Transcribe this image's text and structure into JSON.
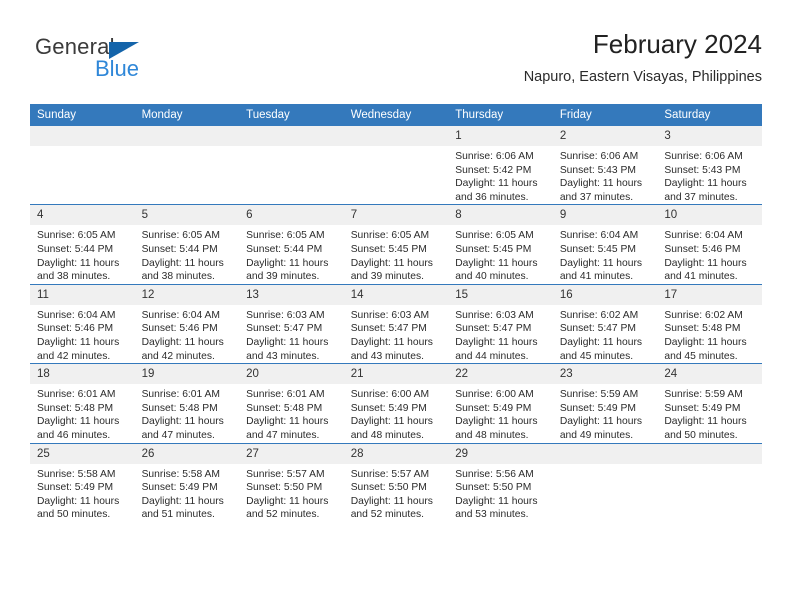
{
  "brand": {
    "name_part1": "General",
    "name_part2": "Blue",
    "triangle_icon": "blue-triangle-icon",
    "accent_blue": "#2f87d8",
    "dark_blue": "#1464aa"
  },
  "header": {
    "title": "February 2024",
    "subtitle": "Napuro, Eastern Visayas, Philippines"
  },
  "theme": {
    "header_row_bg": "#3479bc",
    "daynum_bg": "#f0f0f0",
    "grid_line": "#3479bc",
    "text": "#2b2b2b"
  },
  "weekdays": [
    "Sunday",
    "Monday",
    "Tuesday",
    "Wednesday",
    "Thursday",
    "Friday",
    "Saturday"
  ],
  "weeks": [
    [
      {
        "day": "",
        "sunrise": "",
        "sunset": "",
        "daylight_line1": "",
        "daylight_line2": ""
      },
      {
        "day": "",
        "sunrise": "",
        "sunset": "",
        "daylight_line1": "",
        "daylight_line2": ""
      },
      {
        "day": "",
        "sunrise": "",
        "sunset": "",
        "daylight_line1": "",
        "daylight_line2": ""
      },
      {
        "day": "",
        "sunrise": "",
        "sunset": "",
        "daylight_line1": "",
        "daylight_line2": ""
      },
      {
        "day": "1",
        "sunrise": "Sunrise: 6:06 AM",
        "sunset": "Sunset: 5:42 PM",
        "daylight_line1": "Daylight: 11 hours",
        "daylight_line2": "and 36 minutes."
      },
      {
        "day": "2",
        "sunrise": "Sunrise: 6:06 AM",
        "sunset": "Sunset: 5:43 PM",
        "daylight_line1": "Daylight: 11 hours",
        "daylight_line2": "and 37 minutes."
      },
      {
        "day": "3",
        "sunrise": "Sunrise: 6:06 AM",
        "sunset": "Sunset: 5:43 PM",
        "daylight_line1": "Daylight: 11 hours",
        "daylight_line2": "and 37 minutes."
      }
    ],
    [
      {
        "day": "4",
        "sunrise": "Sunrise: 6:05 AM",
        "sunset": "Sunset: 5:44 PM",
        "daylight_line1": "Daylight: 11 hours",
        "daylight_line2": "and 38 minutes."
      },
      {
        "day": "5",
        "sunrise": "Sunrise: 6:05 AM",
        "sunset": "Sunset: 5:44 PM",
        "daylight_line1": "Daylight: 11 hours",
        "daylight_line2": "and 38 minutes."
      },
      {
        "day": "6",
        "sunrise": "Sunrise: 6:05 AM",
        "sunset": "Sunset: 5:44 PM",
        "daylight_line1": "Daylight: 11 hours",
        "daylight_line2": "and 39 minutes."
      },
      {
        "day": "7",
        "sunrise": "Sunrise: 6:05 AM",
        "sunset": "Sunset: 5:45 PM",
        "daylight_line1": "Daylight: 11 hours",
        "daylight_line2": "and 39 minutes."
      },
      {
        "day": "8",
        "sunrise": "Sunrise: 6:05 AM",
        "sunset": "Sunset: 5:45 PM",
        "daylight_line1": "Daylight: 11 hours",
        "daylight_line2": "and 40 minutes."
      },
      {
        "day": "9",
        "sunrise": "Sunrise: 6:04 AM",
        "sunset": "Sunset: 5:45 PM",
        "daylight_line1": "Daylight: 11 hours",
        "daylight_line2": "and 41 minutes."
      },
      {
        "day": "10",
        "sunrise": "Sunrise: 6:04 AM",
        "sunset": "Sunset: 5:46 PM",
        "daylight_line1": "Daylight: 11 hours",
        "daylight_line2": "and 41 minutes."
      }
    ],
    [
      {
        "day": "11",
        "sunrise": "Sunrise: 6:04 AM",
        "sunset": "Sunset: 5:46 PM",
        "daylight_line1": "Daylight: 11 hours",
        "daylight_line2": "and 42 minutes."
      },
      {
        "day": "12",
        "sunrise": "Sunrise: 6:04 AM",
        "sunset": "Sunset: 5:46 PM",
        "daylight_line1": "Daylight: 11 hours",
        "daylight_line2": "and 42 minutes."
      },
      {
        "day": "13",
        "sunrise": "Sunrise: 6:03 AM",
        "sunset": "Sunset: 5:47 PM",
        "daylight_line1": "Daylight: 11 hours",
        "daylight_line2": "and 43 minutes."
      },
      {
        "day": "14",
        "sunrise": "Sunrise: 6:03 AM",
        "sunset": "Sunset: 5:47 PM",
        "daylight_line1": "Daylight: 11 hours",
        "daylight_line2": "and 43 minutes."
      },
      {
        "day": "15",
        "sunrise": "Sunrise: 6:03 AM",
        "sunset": "Sunset: 5:47 PM",
        "daylight_line1": "Daylight: 11 hours",
        "daylight_line2": "and 44 minutes."
      },
      {
        "day": "16",
        "sunrise": "Sunrise: 6:02 AM",
        "sunset": "Sunset: 5:47 PM",
        "daylight_line1": "Daylight: 11 hours",
        "daylight_line2": "and 45 minutes."
      },
      {
        "day": "17",
        "sunrise": "Sunrise: 6:02 AM",
        "sunset": "Sunset: 5:48 PM",
        "daylight_line1": "Daylight: 11 hours",
        "daylight_line2": "and 45 minutes."
      }
    ],
    [
      {
        "day": "18",
        "sunrise": "Sunrise: 6:01 AM",
        "sunset": "Sunset: 5:48 PM",
        "daylight_line1": "Daylight: 11 hours",
        "daylight_line2": "and 46 minutes."
      },
      {
        "day": "19",
        "sunrise": "Sunrise: 6:01 AM",
        "sunset": "Sunset: 5:48 PM",
        "daylight_line1": "Daylight: 11 hours",
        "daylight_line2": "and 47 minutes."
      },
      {
        "day": "20",
        "sunrise": "Sunrise: 6:01 AM",
        "sunset": "Sunset: 5:48 PM",
        "daylight_line1": "Daylight: 11 hours",
        "daylight_line2": "and 47 minutes."
      },
      {
        "day": "21",
        "sunrise": "Sunrise: 6:00 AM",
        "sunset": "Sunset: 5:49 PM",
        "daylight_line1": "Daylight: 11 hours",
        "daylight_line2": "and 48 minutes."
      },
      {
        "day": "22",
        "sunrise": "Sunrise: 6:00 AM",
        "sunset": "Sunset: 5:49 PM",
        "daylight_line1": "Daylight: 11 hours",
        "daylight_line2": "and 48 minutes."
      },
      {
        "day": "23",
        "sunrise": "Sunrise: 5:59 AM",
        "sunset": "Sunset: 5:49 PM",
        "daylight_line1": "Daylight: 11 hours",
        "daylight_line2": "and 49 minutes."
      },
      {
        "day": "24",
        "sunrise": "Sunrise: 5:59 AM",
        "sunset": "Sunset: 5:49 PM",
        "daylight_line1": "Daylight: 11 hours",
        "daylight_line2": "and 50 minutes."
      }
    ],
    [
      {
        "day": "25",
        "sunrise": "Sunrise: 5:58 AM",
        "sunset": "Sunset: 5:49 PM",
        "daylight_line1": "Daylight: 11 hours",
        "daylight_line2": "and 50 minutes."
      },
      {
        "day": "26",
        "sunrise": "Sunrise: 5:58 AM",
        "sunset": "Sunset: 5:49 PM",
        "daylight_line1": "Daylight: 11 hours",
        "daylight_line2": "and 51 minutes."
      },
      {
        "day": "27",
        "sunrise": "Sunrise: 5:57 AM",
        "sunset": "Sunset: 5:50 PM",
        "daylight_line1": "Daylight: 11 hours",
        "daylight_line2": "and 52 minutes."
      },
      {
        "day": "28",
        "sunrise": "Sunrise: 5:57 AM",
        "sunset": "Sunset: 5:50 PM",
        "daylight_line1": "Daylight: 11 hours",
        "daylight_line2": "and 52 minutes."
      },
      {
        "day": "29",
        "sunrise": "Sunrise: 5:56 AM",
        "sunset": "Sunset: 5:50 PM",
        "daylight_line1": "Daylight: 11 hours",
        "daylight_line2": "and 53 minutes."
      },
      {
        "day": "",
        "sunrise": "",
        "sunset": "",
        "daylight_line1": "",
        "daylight_line2": ""
      },
      {
        "day": "",
        "sunrise": "",
        "sunset": "",
        "daylight_line1": "",
        "daylight_line2": ""
      }
    ]
  ]
}
